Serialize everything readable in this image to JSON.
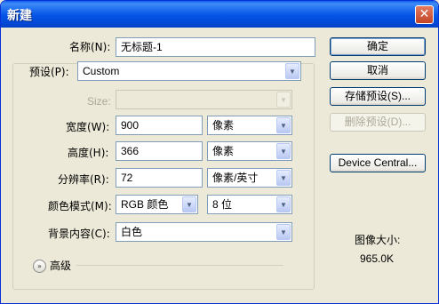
{
  "window": {
    "title": "新建",
    "close_glyph": "✕"
  },
  "name": {
    "label": "名称(N):",
    "value": "无标题-1"
  },
  "preset": {
    "label": "预设(P):",
    "value": "Custom"
  },
  "size": {
    "label": "Size:",
    "value": ""
  },
  "width": {
    "label": "宽度(W):",
    "value": "900",
    "unit": "像素"
  },
  "height": {
    "label": "高度(H):",
    "value": "366",
    "unit": "像素"
  },
  "resolution": {
    "label": "分辨率(R):",
    "value": "72",
    "unit": "像素/英寸"
  },
  "color_mode": {
    "label": "颜色模式(M):",
    "value": "RGB 颜色",
    "depth": "8 位"
  },
  "background": {
    "label": "背景内容(C):",
    "value": "白色"
  },
  "advanced": {
    "label": "高级"
  },
  "buttons": {
    "ok": "确定",
    "cancel": "取消",
    "save_preset": "存储预设(S)...",
    "delete_preset": "删除预设(D)...",
    "device_central": "Device Central..."
  },
  "image_size": {
    "label": "图像大小:",
    "value": "965.0K"
  },
  "icons": {
    "dropdown": "▼",
    "expand": "»"
  }
}
